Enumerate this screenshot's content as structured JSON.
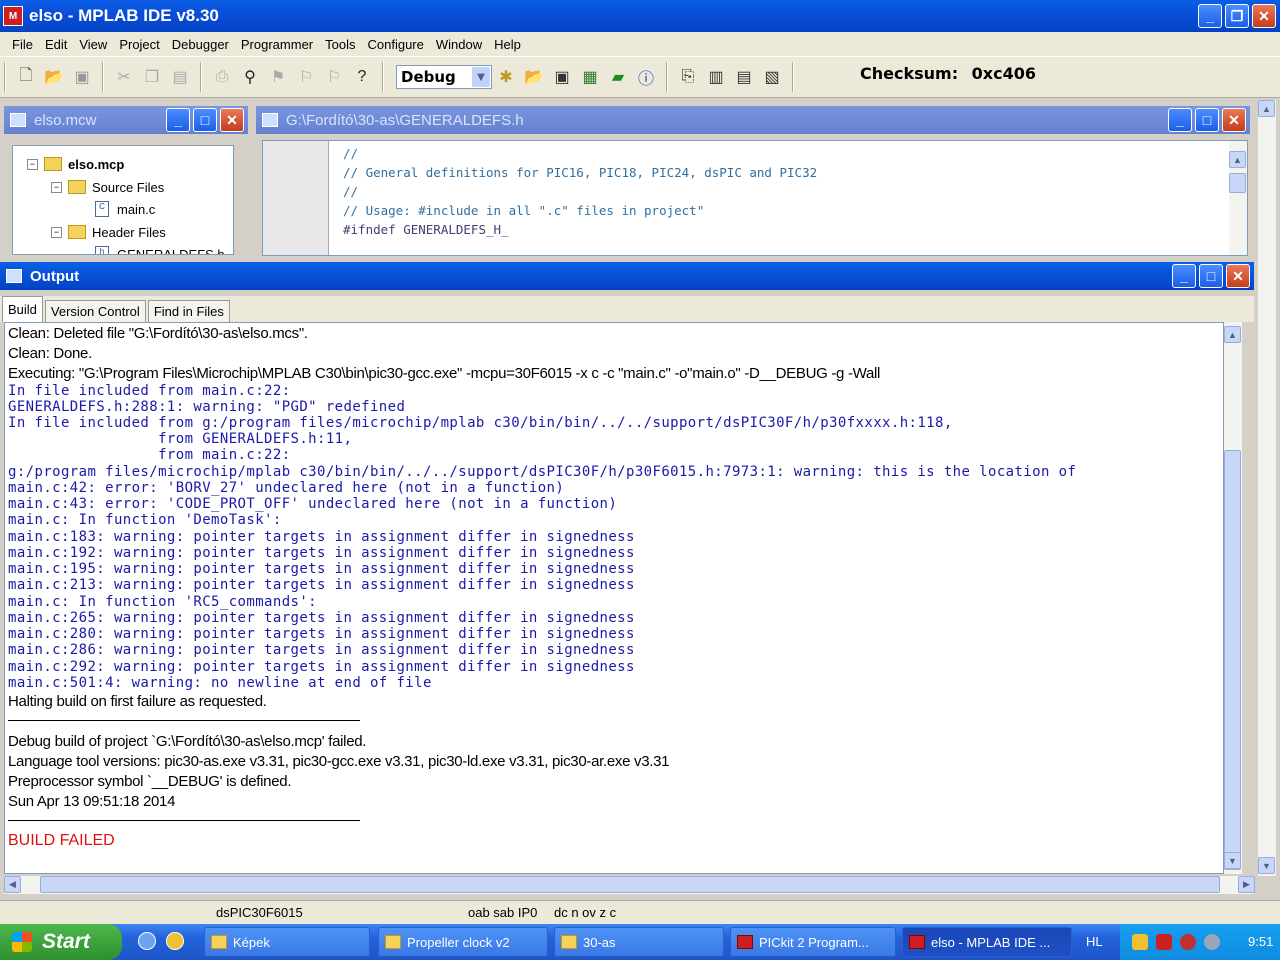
{
  "app": {
    "title": "elso - MPLAB IDE v8.30"
  },
  "menu": [
    "File",
    "Edit",
    "View",
    "Project",
    "Debugger",
    "Programmer",
    "Tools",
    "Configure",
    "Window",
    "Help"
  ],
  "toolbar": {
    "config_value": "Debug",
    "checksum_label": "Checksum:",
    "checksum_value": "0xc406"
  },
  "workspace": {
    "title": "elso.mcw",
    "project": "elso.mcp",
    "source_folder": "Source Files",
    "source_file": "main.c",
    "header_folder": "Header Files",
    "header_file": "GENERALDEFS.h"
  },
  "editor": {
    "title": "G:\\Fordító\\30-as\\GENERALDEFS.h",
    "lines": [
      "//",
      "// General definitions for PIC16, PIC18, PIC24, dsPIC and PIC32",
      "//",
      "// Usage: #include in all \".c\" files in project\"",
      "",
      "#ifndef GENERALDEFS_H_"
    ]
  },
  "output": {
    "title": "Output",
    "tabs": [
      "Build",
      "Version Control",
      "Find in Files"
    ],
    "lines": [
      "Clean: Deleted file \"G:\\Fordító\\30-as\\elso.mcs\".",
      "Clean: Done.",
      "Executing: \"G:\\Program Files\\Microchip\\MPLAB C30\\bin\\pic30-gcc.exe\" -mcpu=30F6015 -x c -c   \"main.c\" -o\"main.o\" -D__DEBUG -g -Wall",
      "In file included from main.c:22:",
      "GENERALDEFS.h:288:1: warning: \"PGD\" redefined",
      "In file included from g:/program files/microchip/mplab c30/bin/bin/../../support/dsPIC30F/h/p30fxxxx.h:118,",
      "                 from GENERALDEFS.h:11,",
      "                 from main.c:22:",
      "g:/program files/microchip/mplab c30/bin/bin/../../support/dsPIC30F/h/p30F6015.h:7973:1: warning: this is the location of",
      "main.c:42: error: 'BORV_27' undeclared here (not in a function)",
      "main.c:43: error: 'CODE_PROT_OFF' undeclared here (not in a function)",
      "main.c: In function 'DemoTask':",
      "main.c:183: warning: pointer targets in assignment differ in signedness",
      "main.c:192: warning: pointer targets in assignment differ in signedness",
      "main.c:195: warning: pointer targets in assignment differ in signedness",
      "main.c:213: warning: pointer targets in assignment differ in signedness",
      "main.c: In function 'RC5_commands':",
      "main.c:265: warning: pointer targets in assignment differ in signedness",
      "main.c:280: warning: pointer targets in assignment differ in signedness",
      "main.c:286: warning: pointer targets in assignment differ in signedness",
      "main.c:292: warning: pointer targets in assignment differ in signedness",
      "main.c:501:4: warning: no newline at end of file",
      "Halting build on first failure as requested."
    ],
    "summary": [
      "Debug build of project `G:\\Fordító\\30-as\\elso.mcp' failed.",
      "Language tool versions: pic30-as.exe v3.31, pic30-gcc.exe v3.31, pic30-ld.exe v3.31, pic30-ar.exe v3.31",
      "Preprocessor symbol `__DEBUG' is defined.",
      "Sun Apr 13 09:51:18 2014"
    ],
    "result": "BUILD FAILED"
  },
  "status": {
    "device": "dsPIC30F6015",
    "flags1": "oab sab IP0",
    "flags2": "dc n ov z c"
  },
  "taskbar": {
    "start": "Start",
    "tasks": [
      "Képek",
      "Propeller clock v2",
      "30-as",
      "PICkit 2 Program...",
      "elso - MPLAB IDE ..."
    ],
    "lang": "HL",
    "clock": "9:51"
  }
}
